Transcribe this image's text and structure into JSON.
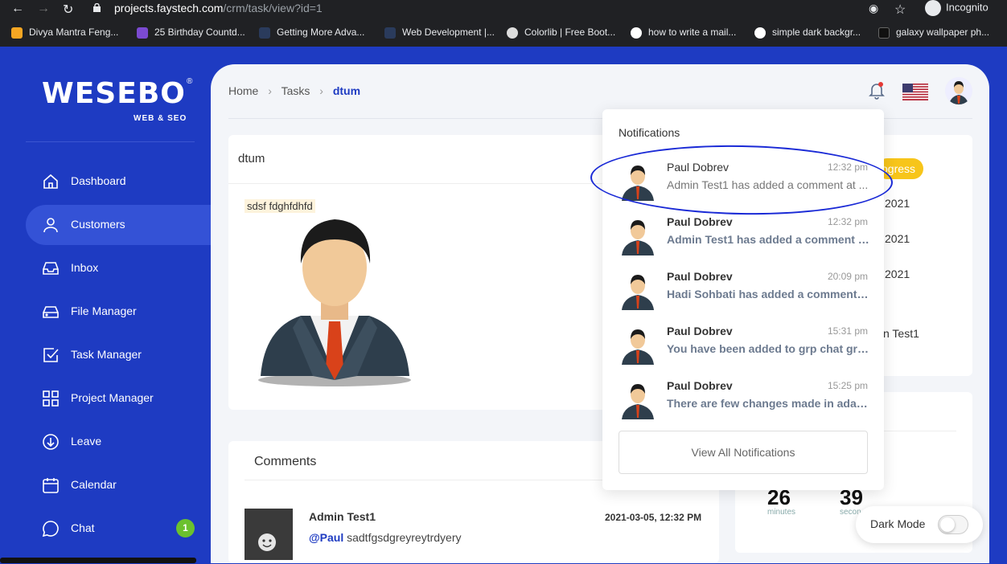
{
  "browser": {
    "url_host": "projects.faystech.com",
    "url_path": "/crm/task/view?id=1",
    "incognito_label": "Incognito",
    "bookmarks": [
      {
        "label": "Divya Mantra Feng...",
        "color": "#f5a623"
      },
      {
        "label": "25 Birthday Countd...",
        "color": "#7b4ad1"
      },
      {
        "label": "Getting More Adva...",
        "color": "#2a3b5c"
      },
      {
        "label": "Web Development |...",
        "color": "#2a3b5c"
      },
      {
        "label": "Colorlib | Free Boot...",
        "color": "#dddddd"
      },
      {
        "label": "how to write a mail...",
        "color": "#ffffff"
      },
      {
        "label": "simple dark backgr...",
        "color": "#ffffff"
      },
      {
        "label": "galaxy wallpaper ph...",
        "color": "#111111"
      }
    ]
  },
  "brand": {
    "name": "WESEBO",
    "tagline": "WEB & SEO",
    "registered": "®"
  },
  "sidebar": {
    "items": [
      {
        "label": "Dashboard",
        "icon": "home-icon"
      },
      {
        "label": "Customers",
        "icon": "user-icon",
        "active": true
      },
      {
        "label": "Inbox",
        "icon": "inbox-icon"
      },
      {
        "label": "File Manager",
        "icon": "drive-icon"
      },
      {
        "label": "Task Manager",
        "icon": "checkbox-icon"
      },
      {
        "label": "Project Manager",
        "icon": "grid-icon"
      },
      {
        "label": "Leave",
        "icon": "arrow-down-circle-icon"
      },
      {
        "label": "Calendar",
        "icon": "calendar-icon"
      },
      {
        "label": "Chat",
        "icon": "chat-icon",
        "badge": "1"
      }
    ]
  },
  "breadcrumb": {
    "home": "Home",
    "sep": "›",
    "tasks": "Tasks",
    "current": "dtum"
  },
  "task": {
    "title": "dtum",
    "description": "sdsf fdghfdhfd"
  },
  "comments": {
    "title": "Comments",
    "items": [
      {
        "author": "Admin Test1",
        "date": "2021-03-05, 12:32 PM",
        "mention": "@Paul",
        "text": "sadtfgsdgreyreytrdyery"
      }
    ]
  },
  "right_panel": {
    "status": "ogress",
    "date1": "2021",
    "date2": "2021",
    "date3": "2021",
    "assignee": "n Test1",
    "timer": {
      "minutes": "26",
      "minutes_label": "minutes",
      "seconds": "39",
      "seconds_label": "secon"
    }
  },
  "notifications": {
    "title": "Notifications",
    "items": [
      {
        "name": "Paul Dobrev",
        "time": "12:32 pm",
        "message": "Admin Test1 has added a comment at ...",
        "unread": false
      },
      {
        "name": "Paul Dobrev",
        "time": "12:32 pm",
        "message": "Admin Test1 has added a comment at...",
        "unread": true
      },
      {
        "name": "Paul Dobrev",
        "time": "20:09 pm",
        "message": "Hadi Sohbati has added a comment at...",
        "unread": true
      },
      {
        "name": "Paul Dobrev",
        "time": "15:31 pm",
        "message": "You have been added to grp chat grou...",
        "unread": true
      },
      {
        "name": "Paul Dobrev",
        "time": "15:25 pm",
        "message": "There are few changes made in adam ...",
        "unread": true
      }
    ],
    "view_all": "View All Notifications"
  },
  "dark_mode": {
    "label": "Dark Mode",
    "enabled": false
  },
  "colors": {
    "primary": "#1e3bc2",
    "badge": "#6bc12e",
    "status": "#f7c51a"
  }
}
